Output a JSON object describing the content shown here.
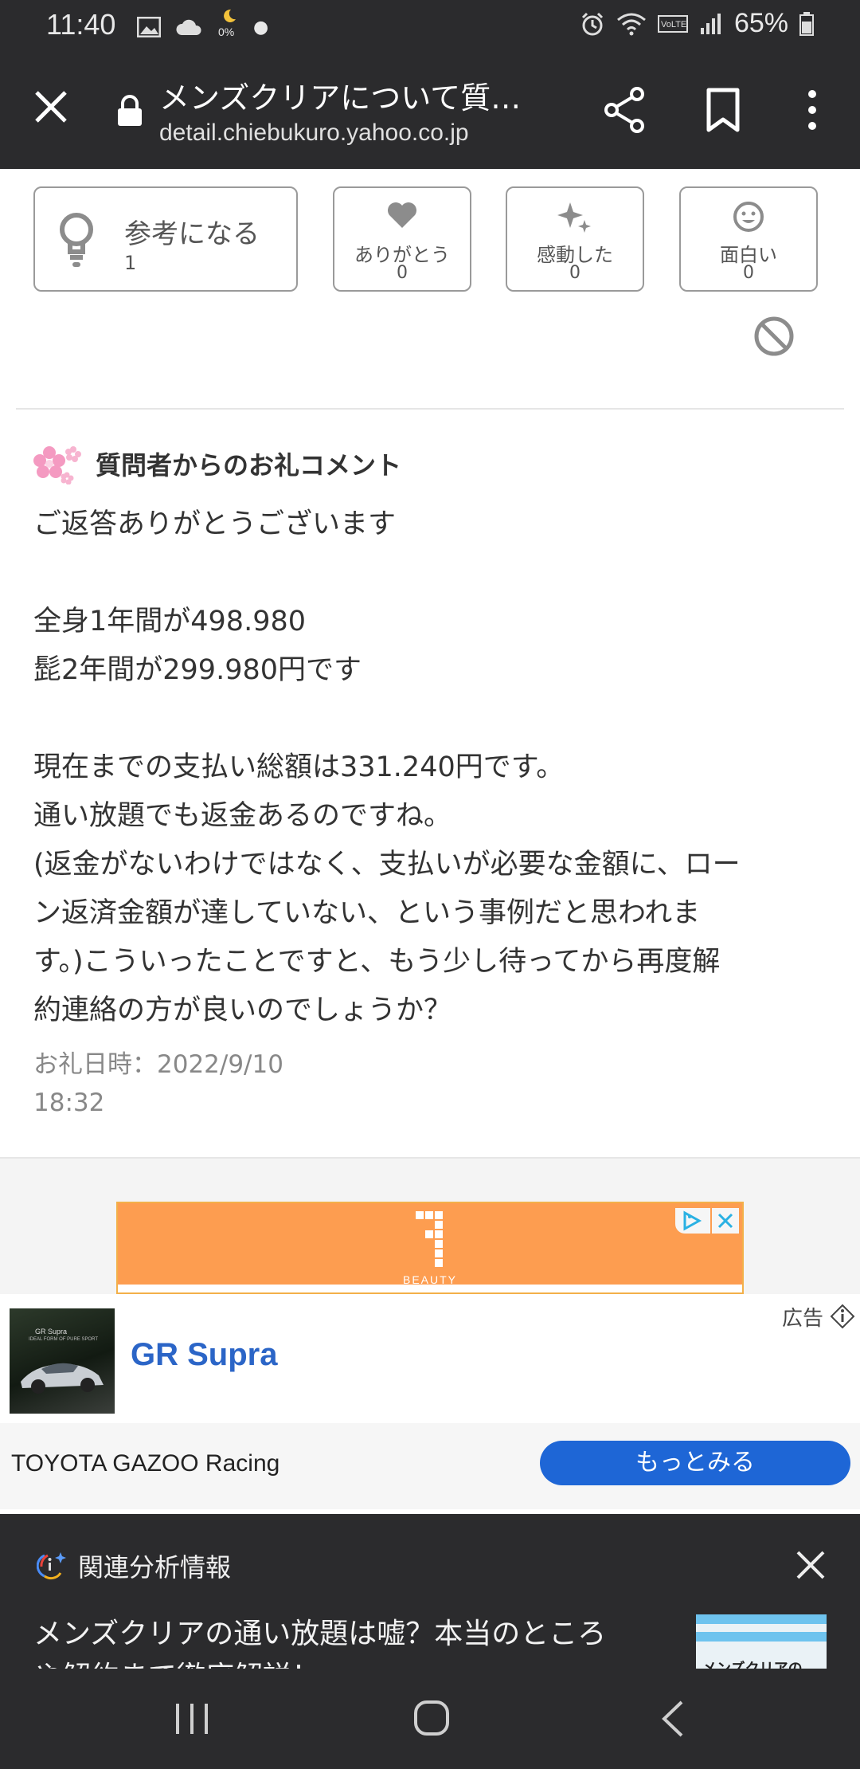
{
  "status_bar": {
    "time": "11:40",
    "battery": "65%",
    "nightlight_badge": "0%"
  },
  "browser": {
    "title": "メンズクリアについて質…",
    "url": "detail.chiebukuro.yahoo.co.jp"
  },
  "reactions": {
    "helpful": {
      "label": "参考になる",
      "count": "1"
    },
    "thanks": {
      "label": "ありがとう",
      "count": "0"
    },
    "moved": {
      "label": "感動した",
      "count": "0"
    },
    "funny": {
      "label": "面白い",
      "count": "0"
    }
  },
  "comment": {
    "heading": "質問者からのお礼コメント",
    "lines": [
      "ご返答ありがとうございます",
      "",
      "全身1年間が498.980",
      "髭2年間が299.980円です",
      "",
      "現在までの支払い総額は331.240円です。",
      "通い放題でも返金あるのですね。",
      "(返金がないわけではなく、支払いが必要な金額に、ロー",
      "ン返済金額が達していない、という事例だと思われま",
      "す。)こういったことですと、もう少し待ってから再度解",
      "約連絡の方が良いのでしょうか？"
    ],
    "date_label": "お礼日時：2022/9/10",
    "time": "18:32"
  },
  "ad_banner": {
    "brand": "BEAUTY"
  },
  "supra_ad": {
    "headline": "GR Supra",
    "ad_label": "広告",
    "advertiser": "TOYOTA GAZOO Racing",
    "cta": "もっとみる",
    "thumb_title": "GR Supra",
    "thumb_subtitle": "IDEAL FORM OF PURE SPORT"
  },
  "related": {
    "heading": "関連分析情報",
    "snippet": "メンズクリアの通い放題は嘘？本当のところや解約まで徹底解説！",
    "thumb_text": "メンズクリアの"
  },
  "colors": {
    "toolbar": "#2b2b2d",
    "accent_blue": "#1e66d6",
    "ad_orange": "#fd9d50"
  }
}
